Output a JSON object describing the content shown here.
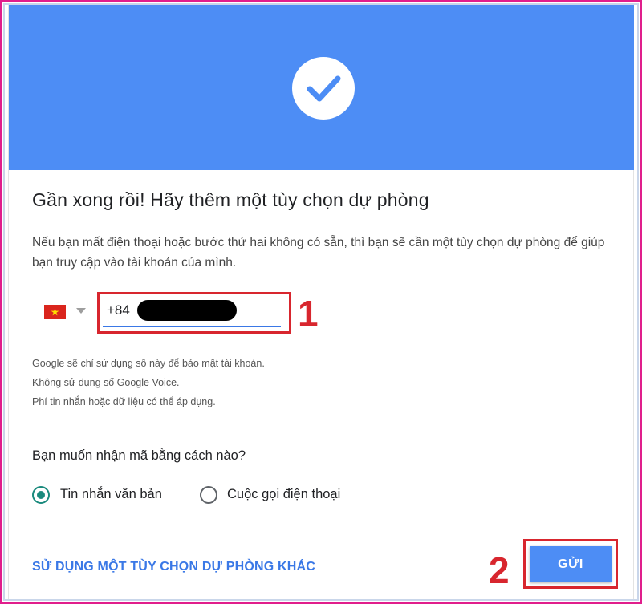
{
  "banner": {
    "icon": "checkmark-icon",
    "color": "#4d8df5"
  },
  "title": "Gần xong rồi! Hãy thêm một tùy chọn dự phòng",
  "description": "Nếu bạn mất điện thoại hoặc bước thứ hai không có sẵn, thì bạn sẽ cần một tùy chọn dự phòng để giúp bạn truy cập vào tài khoản của mình.",
  "phone": {
    "country_flag": "vietnam-flag-icon",
    "prefix": "+84",
    "redacted": true
  },
  "annotations": {
    "step1": "1",
    "step2": "2",
    "highlight_color": "#d8262e"
  },
  "notes": [
    "Google sẽ chỉ sử dụng số này để bảo mật tài khoản.",
    "Không sử dụng số Google Voice.",
    "Phí tin nhắn hoặc dữ liệu có thể áp dụng."
  ],
  "question": "Bạn muốn nhận mã bằng cách nào?",
  "options": [
    {
      "label": "Tin nhắn văn bản",
      "selected": true
    },
    {
      "label": "Cuộc gọi điện thoại",
      "selected": false
    }
  ],
  "actions": {
    "alt_option": "SỬ DỤNG MỘT TÙY CHỌN DỰ PHÒNG KHÁC",
    "send": "GỬI"
  },
  "colors": {
    "accent": "#3a78e6",
    "radio_selected": "#1a8a7d"
  }
}
